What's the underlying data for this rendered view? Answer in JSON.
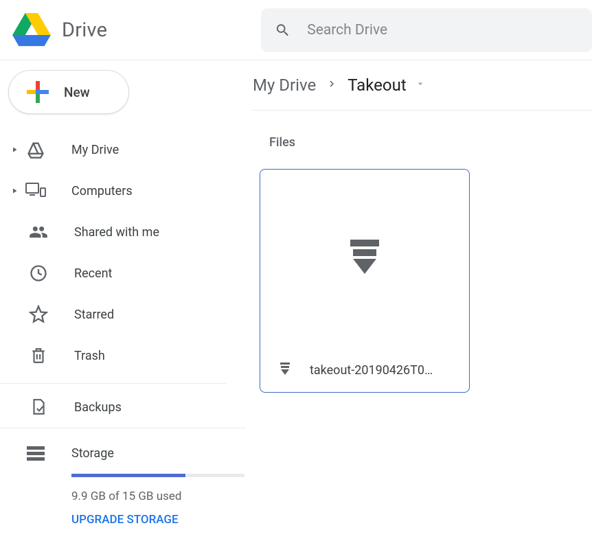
{
  "app": {
    "title": "Drive",
    "search_placeholder": "Search Drive"
  },
  "sidebar": {
    "new_label": "New",
    "items": [
      {
        "label": "My Drive"
      },
      {
        "label": "Computers"
      },
      {
        "label": "Shared with me"
      },
      {
        "label": "Recent"
      },
      {
        "label": "Starred"
      },
      {
        "label": "Trash"
      },
      {
        "label": "Backups"
      }
    ],
    "storage": {
      "label": "Storage",
      "used_text": "9.9 GB of 15 GB used",
      "percent": 66,
      "upgrade_label": "UPGRADE STORAGE"
    }
  },
  "breadcrumb": {
    "root": "My Drive",
    "current": "Takeout"
  },
  "content": {
    "section_label": "Files",
    "files": [
      {
        "name": "takeout-20190426T0…"
      }
    ]
  }
}
